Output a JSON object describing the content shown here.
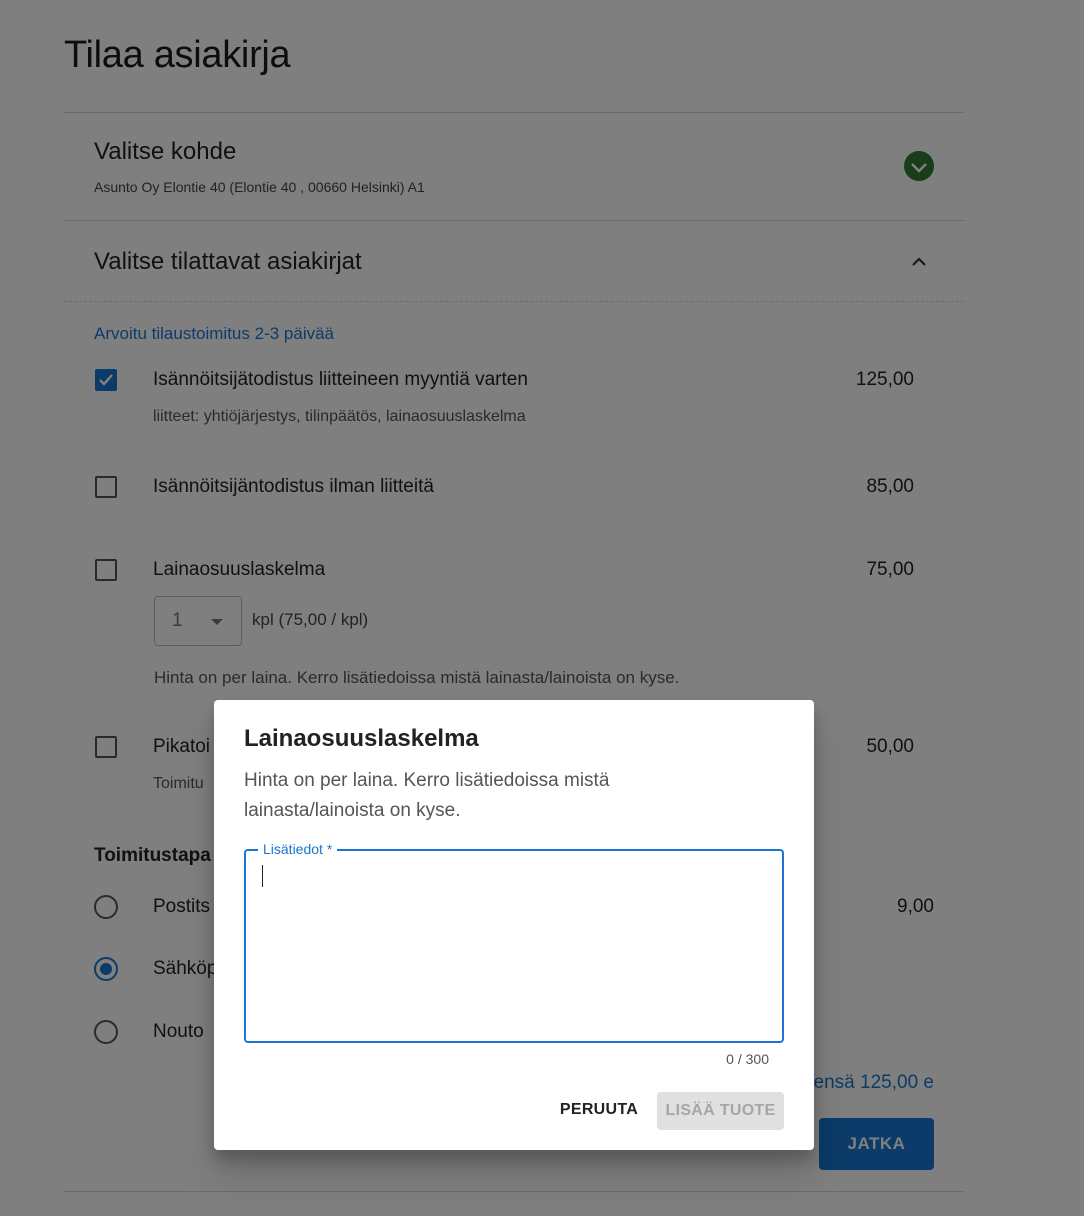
{
  "page": {
    "title": "Tilaa asiakirja"
  },
  "section_target": {
    "title": "Valitse kohde",
    "subtitle": "Asunto Oy Elontie 40 (Elontie 40 , 00660 Helsinki) A1",
    "status_icon": "check-circle-icon",
    "status_color": "#2e7d32"
  },
  "section_documents": {
    "title": "Valitse tilattavat asiakirjat",
    "toggle_icon": "chevron-up-icon",
    "delivery_estimate": "Arvoitu tilaustoimitus 2-3 päivää",
    "items": [
      {
        "label": "Isännöitsijätodistus liitteineen myyntiä varten",
        "price": "125,00",
        "checked": true,
        "note": "liitteet: yhtiöjärjestys, tilinpäätös, lainaosuuslaskelma"
      },
      {
        "label": "Isännöitsijäntodistus ilman liitteitä",
        "price": "85,00",
        "checked": false
      },
      {
        "label": "Lainaosuuslaskelma",
        "price": "75,00",
        "checked": false,
        "quantity": "1",
        "quantity_unit": "kpl (75,00 / kpl)",
        "note": "Hinta on per laina. Kerro lisätiedoissa mistä lainasta/lainoista on kyse."
      },
      {
        "label": "Pikatoi",
        "price": "50,00",
        "checked": false,
        "note": "Toimitu"
      }
    ]
  },
  "delivery": {
    "title": "Toimitustapa",
    "options": [
      {
        "label": "Postits",
        "price": "9,00",
        "selected": false
      },
      {
        "label": "Sähköp",
        "selected": true
      },
      {
        "label": "Nouto",
        "selected": false
      }
    ],
    "total": "ensä 125,00 e",
    "continue_label": "JATKA"
  },
  "dialog": {
    "title": "Lainaosuuslaskelma",
    "text": "Hinta on per laina. Kerro lisätiedoissa mistä lainasta/lainoista on kyse.",
    "field_label": "Lisätiedot *",
    "field_value": "",
    "counter": "0 / 300",
    "cancel_label": "PERUUTA",
    "add_label": "LISÄÄ TUOTE"
  },
  "colors": {
    "accent": "#1976d2",
    "success": "#2e7d32"
  }
}
